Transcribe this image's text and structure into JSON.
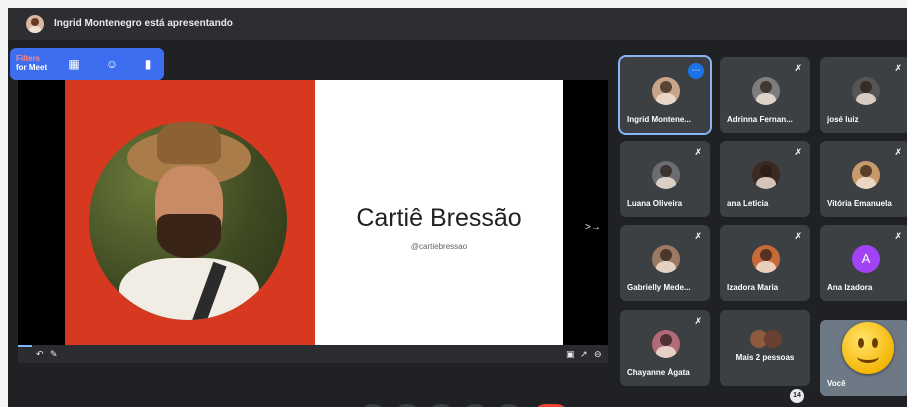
{
  "topbar": {
    "presenting_text": "Ingrid Montenegro está apresentando"
  },
  "filters": {
    "line1": "Filters",
    "line2": "for Meet"
  },
  "slide": {
    "name": "Cartiê Bressão",
    "handle": "@cartiebressao"
  },
  "participants": [
    {
      "name": "Ingrid Montene..."
    },
    {
      "name": "Adrinna Fernan..."
    },
    {
      "name": "josé luiz"
    },
    {
      "name": "Luana Oliveira"
    },
    {
      "name": "ana Leticia"
    },
    {
      "name": "Vitória Emanuela"
    },
    {
      "name": "Gabrielly Mede..."
    },
    {
      "name": "Izadora Maria"
    },
    {
      "name": "Ana Izadora",
      "initial": "A"
    },
    {
      "name": "Chayanne Ágata"
    },
    {
      "name": "Mais 2 pessoas"
    },
    {
      "name": "Você"
    }
  ],
  "badge_count": "14",
  "icons": [
    "presenter-avatar",
    "add-filter-icon",
    "face-filter-icon",
    "comment-icon",
    "next-slide-icon",
    "mic-off-icon",
    "more-options-icon",
    "emoji-smile"
  ]
}
